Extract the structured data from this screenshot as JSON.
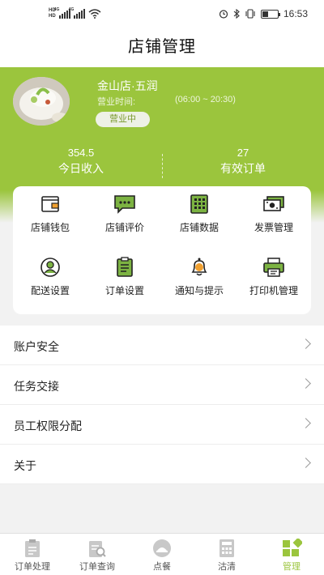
{
  "status_bar": {
    "time": "16:53"
  },
  "header": {
    "title": "店铺管理"
  },
  "store": {
    "name": "金山店·五润",
    "hours_label": "营业时间:",
    "hours_value": "(06:00 ~ 20:30)",
    "status": "营业中"
  },
  "stats": [
    {
      "value": "354.5",
      "label": "今日收入"
    },
    {
      "value": "27",
      "label": "有效订单"
    }
  ],
  "grid": [
    {
      "label": "店铺钱包",
      "icon": "wallet-icon"
    },
    {
      "label": "店铺评价",
      "icon": "comment-icon"
    },
    {
      "label": "店铺数据",
      "icon": "data-grid-icon"
    },
    {
      "label": "发票管理",
      "icon": "invoice-icon"
    },
    {
      "label": "配送设置",
      "icon": "delivery-person-icon"
    },
    {
      "label": "订单设置",
      "icon": "clipboard-icon"
    },
    {
      "label": "通知与提示",
      "icon": "bell-icon"
    },
    {
      "label": "打印机管理",
      "icon": "printer-icon"
    }
  ],
  "menu": [
    {
      "label": "账户安全"
    },
    {
      "label": "任务交接"
    },
    {
      "label": "员工权限分配"
    },
    {
      "label": "关于"
    }
  ],
  "tabs": [
    {
      "label": "订单处理",
      "icon": "order-process-icon"
    },
    {
      "label": "订单查询",
      "icon": "order-search-icon"
    },
    {
      "label": "点餐",
      "icon": "dish-icon"
    },
    {
      "label": "沽清",
      "icon": "calculator-icon"
    },
    {
      "label": "管理",
      "icon": "manage-icon",
      "active": true
    }
  ],
  "colors": {
    "accent": "#9bc53d",
    "icon_orange": "#f0a030",
    "icon_green": "#7cb342"
  }
}
